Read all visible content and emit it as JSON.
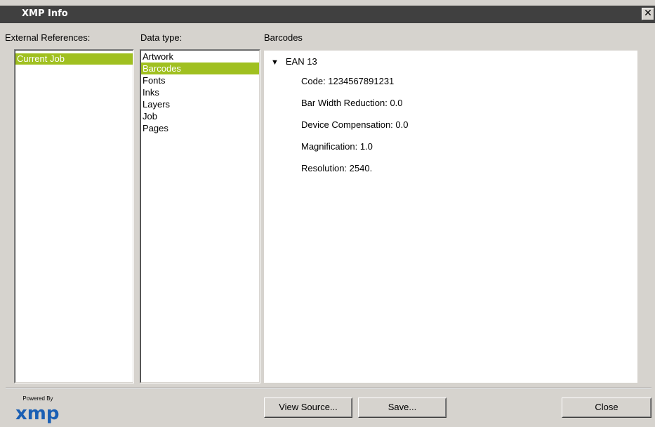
{
  "window": {
    "title": "XMP Info"
  },
  "columns": {
    "external_references": "External References:",
    "data_type": "Data type:",
    "detail": "Barcodes"
  },
  "external_references": [
    {
      "label": "Current Job",
      "selected": true
    }
  ],
  "data_types": [
    {
      "label": "Artwork",
      "selected": false
    },
    {
      "label": "Barcodes",
      "selected": true
    },
    {
      "label": "Fonts",
      "selected": false
    },
    {
      "label": "Inks",
      "selected": false
    },
    {
      "label": "Layers",
      "selected": false
    },
    {
      "label": "Job",
      "selected": false
    },
    {
      "label": "Pages",
      "selected": false
    }
  ],
  "detail": {
    "node": "EAN 13",
    "expanded": true,
    "rows": [
      "Code: 1234567891231",
      "Bar Width Reduction: 0.0",
      "Device Compensation: 0.0",
      "Magnification: 1.0",
      "Resolution: 2540."
    ]
  },
  "buttons": {
    "view_source": "View Source...",
    "save": "Save...",
    "close": "Close"
  },
  "logo": {
    "powered_by": "Powered By",
    "brand": "xmp"
  },
  "colors": {
    "selection": "#a0c020",
    "titlebar": "#404040",
    "face": "#d6d3ce",
    "logo_blue": "#1a5fb4"
  }
}
